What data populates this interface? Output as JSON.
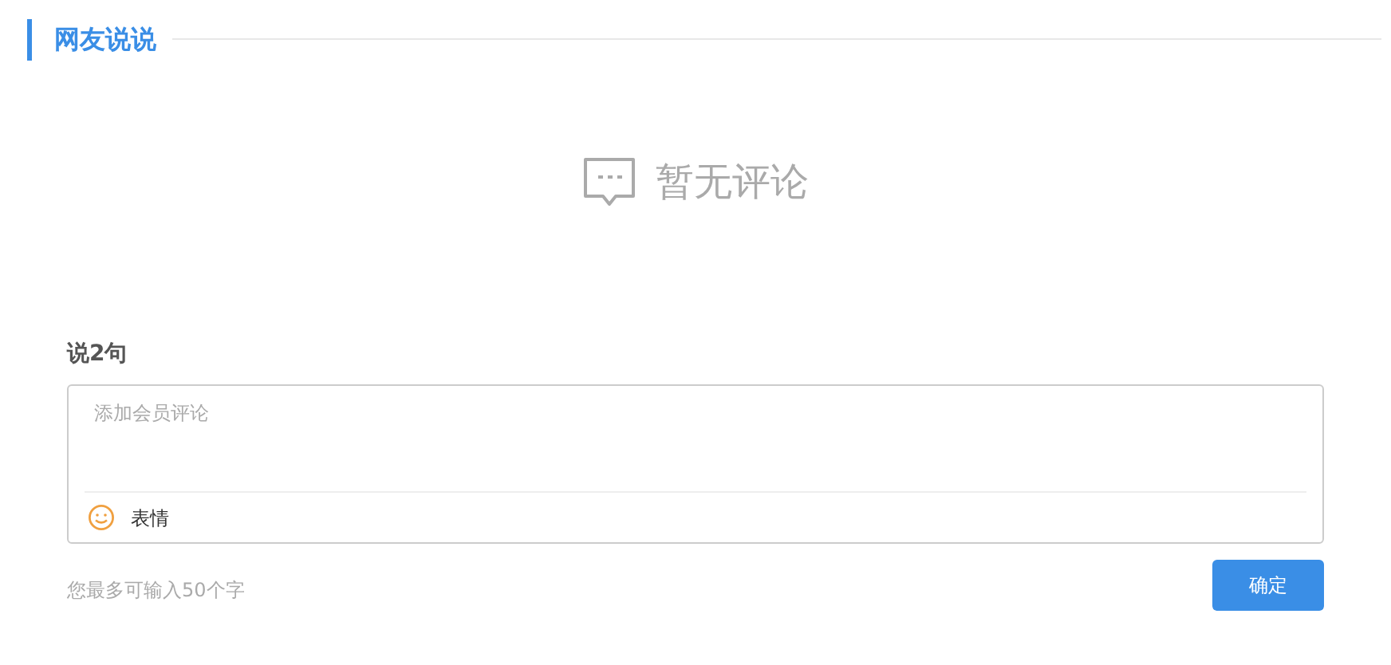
{
  "section": {
    "title": "网友说说"
  },
  "empty_state": {
    "text": "暂无评论"
  },
  "comment_form": {
    "label": "说2句",
    "placeholder": "添加会员评论",
    "emoji_label": "表情",
    "hint": "您最多可输入50个字",
    "submit": "确定"
  }
}
